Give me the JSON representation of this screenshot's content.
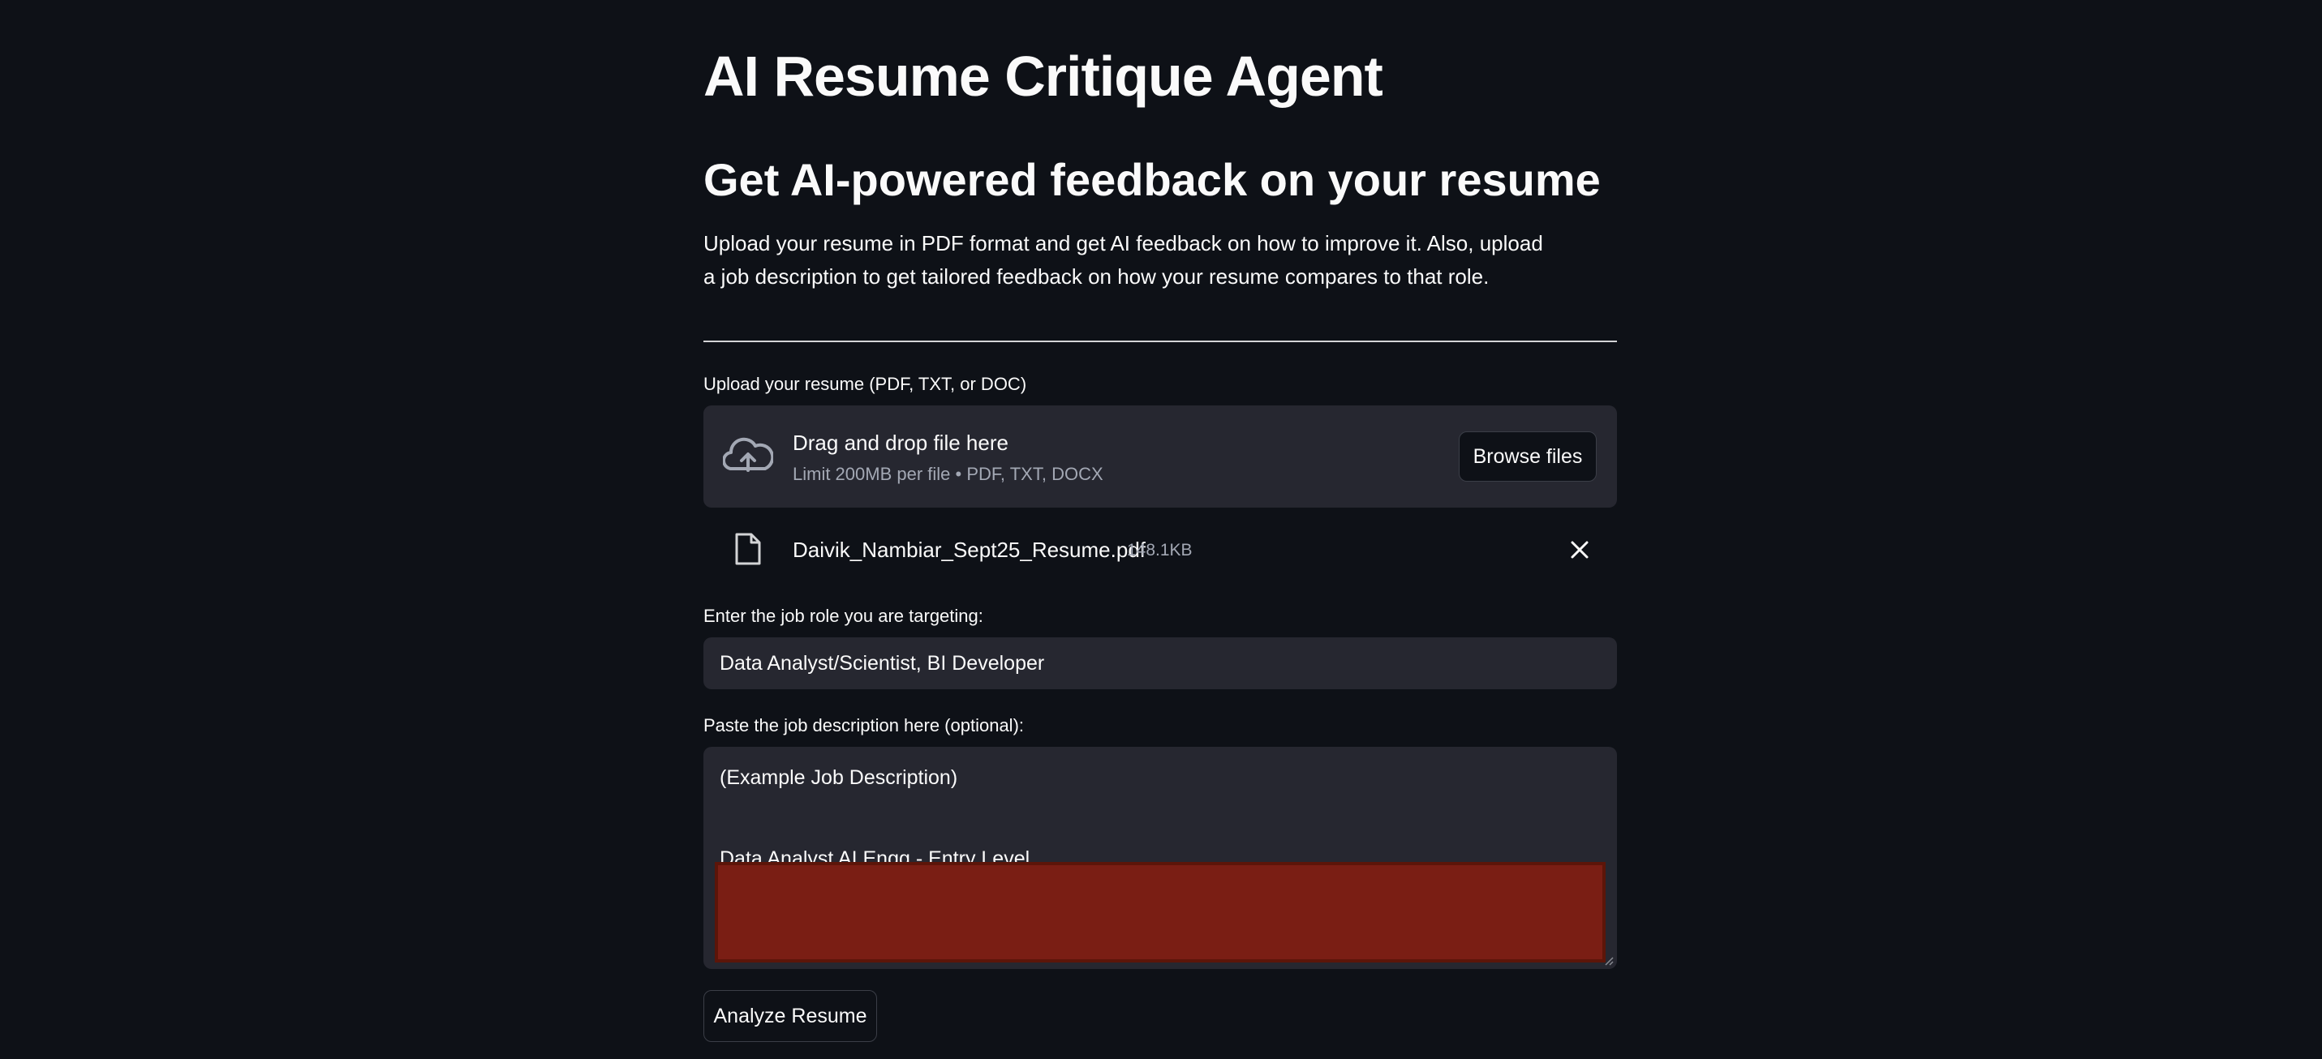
{
  "page": {
    "title": "AI Resume Critique Agent",
    "subtitle": "Get AI-powered feedback on your resume",
    "description": "Upload your resume in PDF format and get AI feedback on how to improve it. Also, upload a job description to get tailored feedback on how your resume compares to that role."
  },
  "uploader": {
    "label": "Upload your resume (PDF, TXT, or DOC)",
    "drop_text": "Drag and drop file here",
    "limit_text": "Limit 200MB per file • PDF, TXT, DOCX",
    "browse_label": "Browse files",
    "icon": "cloud-upload-icon",
    "file": {
      "name": "Daivik_Nambiar_Sept25_Resume.pdf",
      "size": "148.1KB",
      "icon": "file-icon",
      "remove_icon": "close-icon"
    }
  },
  "job_role": {
    "label": "Enter the job role you are targeting:",
    "value": "Data Analyst/Scientist, BI Developer"
  },
  "job_description": {
    "label": "Paste the job description here (optional):",
    "line1": "(Example Job Description)",
    "line2": "Data Analyst AI Engg - Entry Level"
  },
  "actions": {
    "analyze_label": "Analyze Resume"
  },
  "colors": {
    "background": "#0e1117",
    "surface": "#262730",
    "text": "#fafafa",
    "muted_text": "#a3a8b4",
    "redaction": "#7a1e14"
  }
}
